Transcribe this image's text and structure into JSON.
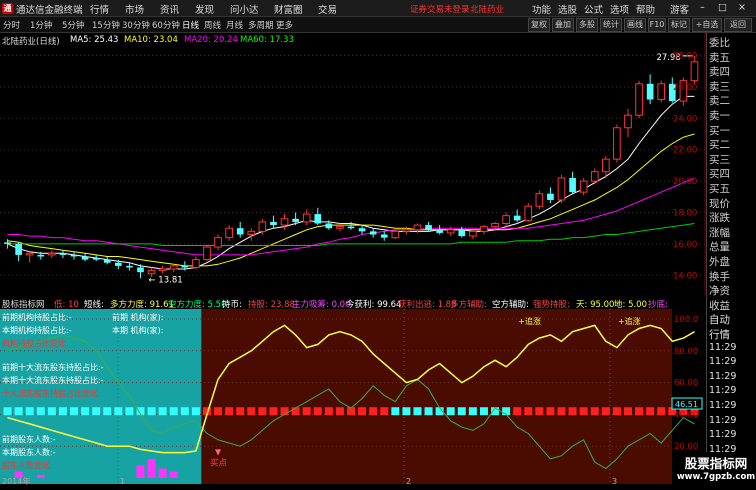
{
  "app": {
    "title": "通达信金融终端",
    "menu": [
      "行情",
      "市场",
      "资讯",
      "发现",
      "问小达",
      "财富圈",
      "交易"
    ],
    "alert_text": "证券交易未登录",
    "stock_name_top": "北陆药业",
    "right_menu": [
      "功能",
      "选股",
      "公式",
      "选项",
      "帮助"
    ],
    "user_label": "游客",
    "window_controls": [
      "–",
      "□",
      "×"
    ]
  },
  "toolbar": {
    "periods": [
      "分时",
      "1分钟",
      "5分钟",
      "15分钟",
      "30分钟",
      "60分钟",
      "日线",
      "周线",
      "月线",
      "多周期",
      "更多"
    ],
    "selected_period": "日线",
    "buttons": [
      "复权",
      "叠加",
      "画线",
      "F10",
      "标记",
      "+自选",
      "返回"
    ],
    "tab_buttons": [
      "复权",
      "叠加",
      "多股",
      "统计",
      "画线",
      "F10",
      "标记",
      "+自选",
      "返回"
    ]
  },
  "main_chart": {
    "stock_title": "北陆药业(日线)",
    "ma_labels": [
      {
        "text": "MA5: 25.43",
        "color": "#ffffff"
      },
      {
        "text": "MA10: 23.04",
        "color": "#ffff00"
      },
      {
        "text": "MA20: 20.24",
        "color": "#ff00ff"
      },
      {
        "text": "MA60: 17.33",
        "color": "#00ff00"
      }
    ],
    "high_label": "27.98",
    "low_label": "13.81",
    "price_ticks": [
      "28.00",
      "26.00",
      "24.00",
      "22.00",
      "20.00",
      "18.00",
      "16.00",
      "14.00"
    ]
  },
  "chart_data": {
    "type": "candlestick",
    "title": "北陆药业(日线)",
    "ylim": [
      13.0,
      28.8
    ],
    "y_ticks": [
      28,
      26,
      24,
      22,
      20,
      18,
      16,
      14
    ],
    "annotations": [
      {
        "text": "27.98",
        "kind": "high"
      },
      {
        "text": "13.81",
        "kind": "low"
      }
    ],
    "candles": [
      [
        16.1,
        16.3,
        15.7,
        16.0
      ],
      [
        16.0,
        16.1,
        14.9,
        15.3
      ],
      [
        15.3,
        15.5,
        14.8,
        15.4
      ],
      [
        15.3,
        15.5,
        15.0,
        15.2
      ],
      [
        15.3,
        15.6,
        15.1,
        15.4
      ],
      [
        15.4,
        15.6,
        15.1,
        15.3
      ],
      [
        15.3,
        15.5,
        15.0,
        15.2
      ],
      [
        15.2,
        15.4,
        14.9,
        15.0
      ],
      [
        15.1,
        15.3,
        14.9,
        15.0
      ],
      [
        15.0,
        15.2,
        14.7,
        14.8
      ],
      [
        14.8,
        15.0,
        14.4,
        14.6
      ],
      [
        14.6,
        14.8,
        14.3,
        14.5
      ],
      [
        14.5,
        14.7,
        13.81,
        14.2
      ],
      [
        14.1,
        14.5,
        13.9,
        14.3
      ],
      [
        14.3,
        14.6,
        14.1,
        14.4
      ],
      [
        14.4,
        14.7,
        14.2,
        14.6
      ],
      [
        14.6,
        14.9,
        14.3,
        14.5
      ],
      [
        14.5,
        15.2,
        14.4,
        15.0
      ],
      [
        15.0,
        15.9,
        14.9,
        15.8
      ],
      [
        15.8,
        16.6,
        15.6,
        16.4
      ],
      [
        16.4,
        17.2,
        16.2,
        17.0
      ],
      [
        17.0,
        17.4,
        16.4,
        16.6
      ],
      [
        16.6,
        17.0,
        16.2,
        16.8
      ],
      [
        16.8,
        17.6,
        16.6,
        17.4
      ],
      [
        17.4,
        17.8,
        17.0,
        17.2
      ],
      [
        17.2,
        17.9,
        16.9,
        17.6
      ],
      [
        17.6,
        18.0,
        17.2,
        17.4
      ],
      [
        17.4,
        18.2,
        17.2,
        17.9
      ],
      [
        17.9,
        18.3,
        17.2,
        17.3
      ],
      [
        17.3,
        17.5,
        16.9,
        17.0
      ],
      [
        17.0,
        17.3,
        16.8,
        17.1
      ],
      [
        17.1,
        17.4,
        16.9,
        17.0
      ],
      [
        17.0,
        17.2,
        16.6,
        16.8
      ],
      [
        16.8,
        17.0,
        16.4,
        16.6
      ],
      [
        16.6,
        16.8,
        16.2,
        16.4
      ],
      [
        16.4,
        16.9,
        16.3,
        16.8
      ],
      [
        16.8,
        17.1,
        16.6,
        16.9
      ],
      [
        16.9,
        17.3,
        16.7,
        17.2
      ],
      [
        17.2,
        17.4,
        16.8,
        16.9
      ],
      [
        16.9,
        17.2,
        16.6,
        16.7
      ],
      [
        16.7,
        17.1,
        16.5,
        16.9
      ],
      [
        16.9,
        17.1,
        16.4,
        16.5
      ],
      [
        16.5,
        16.9,
        16.3,
        16.8
      ],
      [
        16.8,
        17.2,
        16.6,
        17.1
      ],
      [
        17.1,
        17.4,
        16.9,
        17.3
      ],
      [
        17.3,
        18.0,
        17.1,
        17.8
      ],
      [
        17.8,
        18.2,
        17.4,
        17.5
      ],
      [
        17.5,
        18.6,
        17.4,
        18.4
      ],
      [
        18.4,
        19.4,
        18.2,
        19.2
      ],
      [
        19.2,
        19.6,
        18.6,
        18.8
      ],
      [
        18.8,
        20.4,
        18.6,
        20.2
      ],
      [
        20.2,
        20.6,
        19.2,
        19.3
      ],
      [
        19.3,
        20.2,
        19.1,
        20.0
      ],
      [
        20.0,
        20.8,
        19.8,
        20.6
      ],
      [
        20.6,
        21.6,
        20.2,
        21.4
      ],
      [
        21.4,
        23.6,
        21.2,
        23.4
      ],
      [
        23.4,
        24.6,
        22.8,
        24.2
      ],
      [
        24.2,
        26.4,
        24.0,
        26.2
      ],
      [
        26.2,
        26.8,
        24.9,
        25.2
      ],
      [
        25.2,
        26.4,
        25.0,
        26.2
      ],
      [
        26.2,
        26.6,
        25.0,
        25.1
      ],
      [
        25.1,
        26.6,
        24.8,
        26.4
      ],
      [
        26.4,
        27.98,
        26.2,
        27.6
      ]
    ],
    "series": [
      {
        "name": "MA5",
        "color": "#ffffff",
        "values": [
          16.0,
          15.7,
          15.5,
          15.4,
          15.4,
          15.4,
          15.3,
          15.2,
          15.1,
          15.0,
          14.9,
          14.8,
          14.6,
          14.5,
          14.4,
          14.4,
          14.4,
          14.5,
          14.8,
          15.2,
          15.7,
          16.1,
          16.5,
          16.8,
          17.0,
          17.1,
          17.3,
          17.5,
          17.4,
          17.4,
          17.3,
          17.3,
          17.2,
          17.0,
          16.9,
          16.8,
          16.8,
          16.8,
          16.8,
          16.9,
          16.9,
          16.9,
          16.8,
          16.8,
          16.9,
          17.1,
          17.3,
          17.6,
          17.9,
          18.3,
          18.8,
          19.2,
          19.5,
          19.9,
          20.3,
          20.8,
          21.4,
          22.4,
          23.3,
          24.2,
          24.9,
          25.4,
          25.4
        ]
      },
      {
        "name": "MA10",
        "color": "#ffff00",
        "values": [
          16.2,
          16.1,
          15.9,
          15.8,
          15.7,
          15.6,
          15.5,
          15.4,
          15.3,
          15.2,
          15.2,
          15.1,
          15.0,
          14.9,
          14.8,
          14.7,
          14.6,
          14.6,
          14.6,
          14.7,
          14.9,
          15.1,
          15.4,
          15.7,
          16.0,
          16.3,
          16.6,
          16.9,
          17.1,
          17.2,
          17.2,
          17.2,
          17.2,
          17.2,
          17.1,
          17.0,
          17.0,
          16.9,
          16.9,
          16.9,
          16.9,
          16.9,
          16.9,
          16.9,
          16.9,
          16.9,
          17.0,
          17.2,
          17.4,
          17.6,
          17.9,
          18.2,
          18.5,
          18.8,
          19.2,
          19.6,
          20.1,
          20.7,
          21.3,
          21.9,
          22.4,
          22.8,
          23.0
        ]
      },
      {
        "name": "MA20",
        "color": "#ff00ff",
        "values": [
          16.6,
          16.6,
          16.5,
          16.5,
          16.4,
          16.4,
          16.3,
          16.2,
          16.2,
          16.1,
          16.0,
          15.9,
          15.8,
          15.7,
          15.6,
          15.5,
          15.4,
          15.3,
          15.3,
          15.3,
          15.3,
          15.3,
          15.3,
          15.4,
          15.5,
          15.6,
          15.7,
          15.8,
          16.0,
          16.1,
          16.3,
          16.4,
          16.6,
          16.7,
          16.8,
          16.9,
          16.9,
          16.9,
          17.0,
          17.0,
          17.0,
          17.0,
          17.0,
          17.0,
          17.0,
          17.0,
          17.0,
          17.0,
          17.1,
          17.2,
          17.3,
          17.4,
          17.5,
          17.7,
          17.9,
          18.1,
          18.4,
          18.7,
          19.0,
          19.3,
          19.6,
          19.9,
          20.2
        ]
      },
      {
        "name": "MA60",
        "color": "#00cc00",
        "values": [
          16.0,
          16.0,
          16.0,
          16.0,
          16.0,
          16.0,
          16.0,
          16.0,
          16.0,
          16.0,
          16.0,
          16.0,
          16.0,
          16.0,
          15.9,
          15.9,
          15.9,
          15.9,
          15.9,
          15.9,
          15.9,
          15.9,
          15.9,
          15.9,
          15.9,
          15.9,
          15.9,
          15.9,
          15.9,
          16.0,
          16.0,
          16.0,
          16.0,
          16.0,
          16.0,
          16.0,
          16.0,
          16.0,
          16.0,
          16.0,
          16.0,
          16.1,
          16.1,
          16.1,
          16.1,
          16.1,
          16.2,
          16.2,
          16.2,
          16.3,
          16.3,
          16.4,
          16.4,
          16.5,
          16.6,
          16.6,
          16.7,
          16.8,
          16.9,
          17.0,
          17.1,
          17.2,
          17.3
        ]
      }
    ],
    "indicator": {
      "name": "股标指标网",
      "ylim": [
        0,
        100
      ],
      "y_ticks": [
        100,
        80,
        60,
        40,
        20
      ],
      "current_value_label": "46.51",
      "yellow_line": [
        38,
        36,
        34,
        32,
        30,
        28,
        26,
        24,
        22,
        20,
        20,
        20,
        18,
        17,
        16,
        16,
        16,
        17,
        40,
        62,
        72,
        76,
        80,
        86,
        92,
        96,
        90,
        82,
        84,
        90,
        92,
        90,
        86,
        78,
        72,
        66,
        60,
        62,
        68,
        72,
        66,
        60,
        64,
        70,
        74,
        70,
        76,
        84,
        88,
        90,
        86,
        92,
        94,
        96,
        86,
        82,
        90,
        94,
        96,
        94,
        86,
        88,
        92
      ],
      "green_line": [
        80,
        82,
        84,
        86,
        88,
        90,
        88,
        86,
        80,
        70,
        60,
        52,
        40,
        30,
        28,
        32,
        34,
        36,
        28,
        24,
        22,
        20,
        24,
        30,
        36,
        40,
        44,
        48,
        52,
        56,
        48,
        44,
        50,
        58,
        52,
        48,
        58,
        62,
        56,
        44,
        36,
        32,
        30,
        34,
        44,
        40,
        32,
        28,
        20,
        12,
        14,
        20,
        24,
        10,
        6,
        12,
        20,
        24,
        28,
        22,
        30,
        38,
        34
      ],
      "squares": [
        "cyan",
        "cyan",
        "cyan",
        "cyan",
        "cyan",
        "cyan",
        "cyan",
        "cyan",
        "cyan",
        "cyan",
        "cyan",
        "cyan",
        "cyan",
        "cyan",
        "cyan",
        "cyan",
        "cyan",
        "cyan",
        "red",
        "red",
        "red",
        "red",
        "red",
        "red",
        "red",
        "red",
        "red",
        "red",
        "red",
        "red",
        "red",
        "red",
        "red",
        "red",
        "red",
        "cyan",
        "cyan",
        "cyan",
        "cyan",
        "cyan",
        "cyan",
        "cyan",
        "cyan",
        "cyan",
        "cyan",
        "cyan",
        "red",
        "red",
        "red",
        "red",
        "red",
        "red",
        "red",
        "red",
        "red",
        "red",
        "red",
        "red",
        "red",
        "red",
        "red",
        "red",
        "red"
      ],
      "bars": [
        0,
        4,
        0,
        2,
        0,
        0,
        0,
        0,
        0,
        0,
        0,
        0,
        8,
        12,
        6,
        4,
        0,
        0,
        0,
        0,
        0,
        0,
        0,
        0,
        0,
        0,
        0,
        0,
        0,
        0,
        0,
        0,
        0,
        0,
        0,
        0,
        0,
        0,
        0,
        0,
        0,
        0,
        0,
        0,
        0,
        0,
        0,
        0,
        0,
        0,
        0,
        0,
        0,
        0,
        0,
        0,
        0,
        0,
        0,
        0,
        0,
        0,
        0
      ],
      "markers": [
        {
          "text": "买点",
          "index": 19
        },
        {
          "text": "+追涨",
          "index": 47
        },
        {
          "text": "+追涨",
          "index": 56
        }
      ]
    }
  },
  "indicator_panel": {
    "title": "股标指标网",
    "info_items": [
      {
        "text": "低: 10",
        "color": "#ff4040"
      },
      {
        "text": "短线:",
        "color": "#ffffff"
      },
      {
        "text": "多方力度: 91.61",
        "color": "#ffff40"
      },
      {
        "text": "空方力度: 5.50",
        "color": "#00ff80"
      },
      {
        "text": "持币:",
        "color": "#ffffff"
      },
      {
        "text": "持股: 23.88",
        "color": "#ff4040"
      },
      {
        "text": "主力吸筹: 0.00",
        "color": "#ff40ff"
      },
      {
        "text": "今获利: 99.64",
        "color": "#ffffff"
      },
      {
        "text": "获利出逃: 1.88",
        "color": "#ff4040"
      },
      {
        "text": "多方辅助:",
        "color": "#ff4040"
      },
      {
        "text": "空方辅助:",
        "color": "#ffffff"
      },
      {
        "text": "强势持股:",
        "color": "#ff4040"
      },
      {
        "text": "天: 95.00",
        "color": "#ffff40"
      },
      {
        "text": "地: 5.00",
        "color": "#ffff40"
      },
      {
        "text": "抄底:",
        "color": "#ff40ff"
      }
    ],
    "left_labels": [
      {
        "text": "前期机构持股占比:-",
        "color": "#ffffff"
      },
      {
        "text": "本期机构持股占比:-",
        "color": "#ffffff"
      },
      {
        "text": "机构持股占比变化:",
        "color": "#ff3030"
      },
      {
        "text": "前期十大流东股东持股占比:-",
        "color": "#ffffff"
      },
      {
        "text": "本期十大流东股东持股占比:-",
        "color": "#ffffff"
      },
      {
        "text": "十大流东股东持股占比变化:",
        "color": "#ff3030"
      },
      {
        "text": "前期股东人数:-",
        "color": "#ffffff"
      },
      {
        "text": "本期股东人数:-",
        "color": "#ffffff"
      },
      {
        "text": "股东人数变化:",
        "color": "#ff3030"
      }
    ],
    "mid_labels": [
      "前期 机构(家):",
      "本期 机构(家):"
    ],
    "value_label": "46.51",
    "ticks": [
      "100.0",
      "80.00",
      "60.00",
      "40.00",
      "20.00"
    ],
    "buy_label": "买点",
    "chase_labels": [
      "+追涨",
      "+追涨"
    ],
    "date_labels": [
      "2014年",
      "1",
      "2",
      "3"
    ]
  },
  "right_panel": {
    "items": [
      "委比",
      "卖五",
      "卖四",
      "卖三",
      "卖二",
      "卖一",
      "买一",
      "买二",
      "买三",
      "买四",
      "买五",
      "现价",
      "涨跌",
      "涨幅",
      "总量",
      "外盘",
      "换手",
      "净资",
      "收益",
      "自动",
      "行情",
      "11:29",
      "11:29",
      "11:29",
      "11:29",
      "11:29",
      "11:29",
      "11:29",
      "11:29",
      "11:29",
      "11:29"
    ]
  },
  "watermark": {
    "line1": "股票指标网",
    "line2": "www.7gpzb.com"
  },
  "colors": {
    "up": "#ff3232",
    "down": "#54ffff",
    "indicator_bg_left": "#17a3a3",
    "indicator_bg_right": "#4a0b00"
  }
}
